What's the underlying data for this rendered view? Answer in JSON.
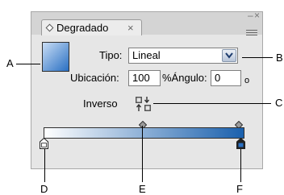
{
  "panel": {
    "tab_label": "Degradado",
    "tab_close": "×",
    "minimize_glyph": "–",
    "close_glyph": "×"
  },
  "form": {
    "type_label": "Tipo:",
    "type_value": "Lineal",
    "location_label": "Ubicación:",
    "location_value": "100",
    "angle_label": "%Ángulo:",
    "angle_value": "0",
    "degree_symbol": "o",
    "reverse_label": "Inverso"
  },
  "gradient": {
    "start_color": "#ffffff",
    "end_color": "#1a60ad"
  },
  "callouts": [
    "A",
    "B",
    "C",
    "D",
    "E",
    "F"
  ],
  "colors": {
    "panel_bg": "#e6e6e6",
    "swatch_end": "#2a70c3"
  }
}
